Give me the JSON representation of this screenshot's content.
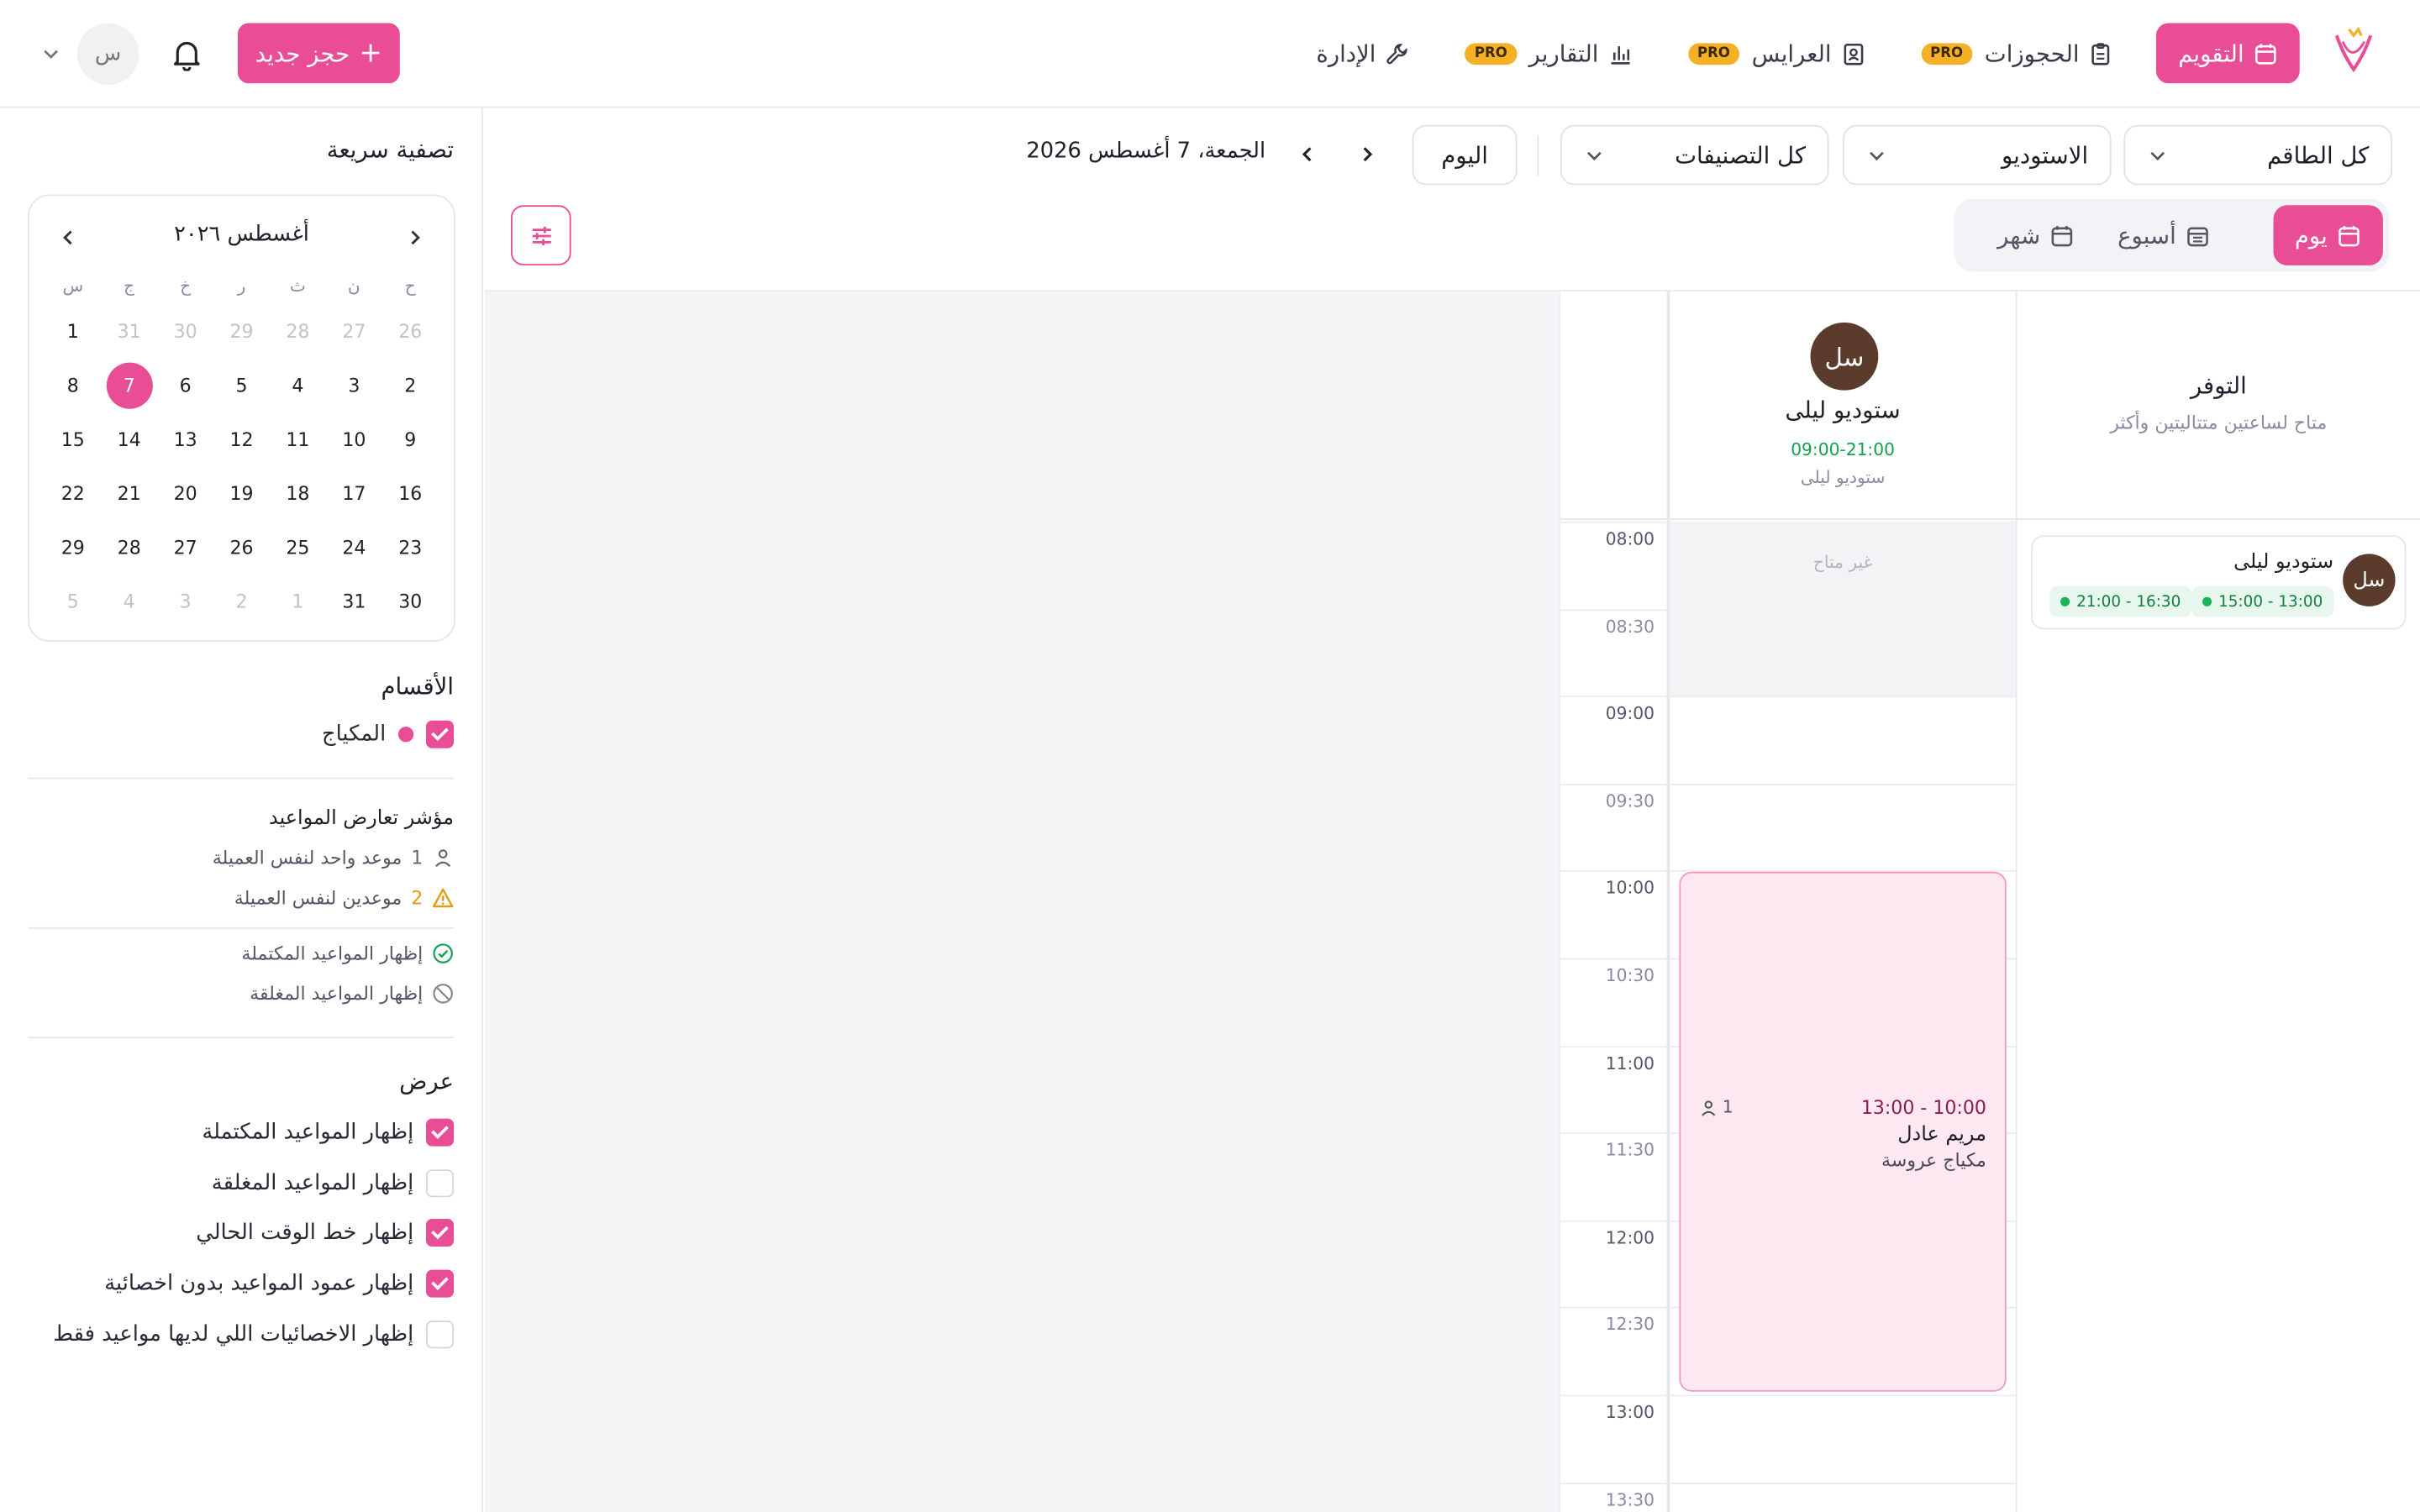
{
  "nav": {
    "items": [
      {
        "label": "التقويم",
        "icon": "calendar-icon",
        "active": true,
        "pro": ""
      },
      {
        "label": "الحجوزات",
        "icon": "clipboard-icon",
        "active": false,
        "pro": "PRO"
      },
      {
        "label": "العرايس",
        "icon": "contact-icon",
        "active": false,
        "pro": "PRO"
      },
      {
        "label": "التقارير",
        "icon": "chart-icon",
        "active": false,
        "pro": "PRO"
      },
      {
        "label": "الإدارة",
        "icon": "wrench-icon",
        "active": false,
        "pro": ""
      }
    ],
    "new_booking": "حجز جديد",
    "avatar_initial": "س"
  },
  "sidebar": {
    "title": "تصفية سريعة",
    "calendar": {
      "month_label": "أغسطس ٢٠٢٦",
      "weekdays": [
        "ح",
        "ن",
        "ث",
        "ر",
        "خ",
        "ج",
        "س"
      ],
      "days": [
        {
          "d": "26",
          "m": true
        },
        {
          "d": "27",
          "m": true
        },
        {
          "d": "28",
          "m": true
        },
        {
          "d": "29",
          "m": true
        },
        {
          "d": "30",
          "m": true
        },
        {
          "d": "31",
          "m": true
        },
        {
          "d": "1",
          "m": false
        },
        {
          "d": "2",
          "m": false
        },
        {
          "d": "3",
          "m": false
        },
        {
          "d": "4",
          "m": false
        },
        {
          "d": "5",
          "m": false
        },
        {
          "d": "6",
          "m": false
        },
        {
          "d": "7",
          "m": false,
          "sel": true
        },
        {
          "d": "8",
          "m": false
        },
        {
          "d": "9",
          "m": false
        },
        {
          "d": "10",
          "m": false
        },
        {
          "d": "11",
          "m": false
        },
        {
          "d": "12",
          "m": false
        },
        {
          "d": "13",
          "m": false
        },
        {
          "d": "14",
          "m": false
        },
        {
          "d": "15",
          "m": false
        },
        {
          "d": "16",
          "m": false
        },
        {
          "d": "17",
          "m": false
        },
        {
          "d": "18",
          "m": false
        },
        {
          "d": "19",
          "m": false
        },
        {
          "d": "20",
          "m": false
        },
        {
          "d": "21",
          "m": false
        },
        {
          "d": "22",
          "m": false
        },
        {
          "d": "23",
          "m": false
        },
        {
          "d": "24",
          "m": false
        },
        {
          "d": "25",
          "m": false
        },
        {
          "d": "26",
          "m": false
        },
        {
          "d": "27",
          "m": false
        },
        {
          "d": "28",
          "m": false
        },
        {
          "d": "29",
          "m": false
        },
        {
          "d": "30",
          "m": false
        },
        {
          "d": "31",
          "m": false
        },
        {
          "d": "1",
          "m": true
        },
        {
          "d": "2",
          "m": true
        },
        {
          "d": "3",
          "m": true
        },
        {
          "d": "4",
          "m": true
        },
        {
          "d": "5",
          "m": true
        }
      ]
    },
    "sections_title": "الأقسام",
    "section_item": "المكياج",
    "conflict_title": "مؤشر تعارض المواعيد",
    "conflict_one_count": "1",
    "conflict_one": "موعد واحد لنفس العميلة",
    "conflict_two_count": "2",
    "conflict_two": "موعدين لنفس العميلة",
    "legend_completed": "إظهار المواعيد المكتملة",
    "legend_closed": "إظهار المواعيد المغلقة",
    "display_title": "عرض",
    "options": [
      {
        "label": "إظهار المواعيد المكتملة",
        "checked": true
      },
      {
        "label": "إظهار المواعيد المغلقة",
        "checked": false
      },
      {
        "label": "إظهار خط الوقت الحالي",
        "checked": true
      },
      {
        "label": "إظهار عمود المواعيد بدون اخصائية",
        "checked": true
      },
      {
        "label": "إظهار الاخصائيات اللي لديها مواعيد فقط",
        "checked": false
      }
    ]
  },
  "toolbar": {
    "staff_select": "كل الطاقم",
    "studio_select": "الاستوديو",
    "category_select": "كل التصنيفات",
    "today": "اليوم",
    "date": "الجمعة، 7 أغسطس 2026",
    "views": {
      "day": "يوم",
      "week": "أسبوع",
      "month": "شهر"
    }
  },
  "grid": {
    "times": [
      "08:00",
      "08:30",
      "09:00",
      "09:30",
      "10:00",
      "10:30",
      "11:00",
      "11:30",
      "12:00",
      "12:30",
      "13:00",
      "13:30"
    ],
    "staff": {
      "initials": "سل",
      "name": "ستوديو ليلى",
      "hours": "09:00-21:00",
      "sub": "ستوديو ليلى",
      "unavailable": "غير متاح"
    },
    "appointment": {
      "time": "10:00 - 13:00",
      "client": "مريم عادل",
      "service": "مكياج عروسة",
      "count": "1"
    },
    "availability": {
      "title": "التوفر",
      "subtitle": "متاح لساعتين متتاليتين وأكثر",
      "initials": "سل",
      "name": "ستوديو ليلى",
      "slot1": "13:00 - 15:00",
      "slot2": "16:30 - 21:00"
    }
  },
  "colors": {
    "accent": "#e84d95",
    "pro": "#f5b025",
    "available": "#12a150"
  }
}
